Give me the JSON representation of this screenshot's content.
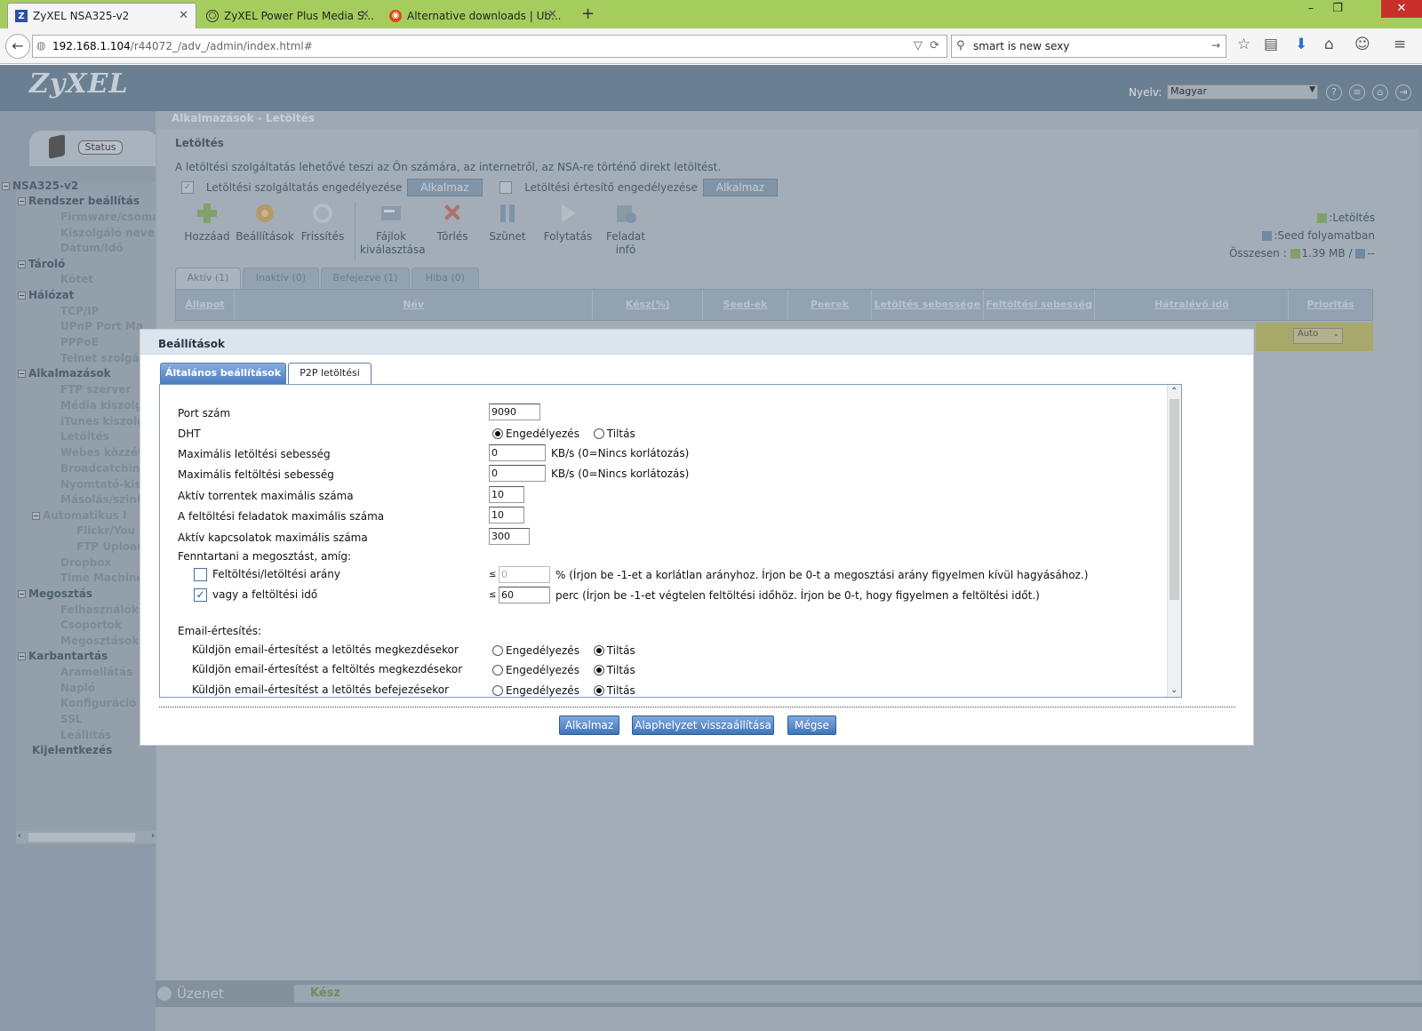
{
  "browser": {
    "tabs": [
      {
        "title": "ZyXEL NSA325-v2"
      },
      {
        "title": "ZyXEL Power Plus Media S..."
      },
      {
        "title": "Alternative downloads | Ub..."
      }
    ],
    "url_host": "192.168.1.104",
    "url_path": "/r44072_/adv_/admin/index.html#",
    "search_value": "smart is new sexy"
  },
  "app": {
    "logo": "ZyXEL",
    "language_label": "Nyelv:",
    "language_value": "Magyar",
    "status_button": "Status",
    "breadcrumb": "Alkalmazások - Letöltés",
    "statusbar": {
      "message": "Üzenet",
      "ready": "Kész"
    }
  },
  "tree": [
    {
      "label": "NSA325-v2"
    },
    {
      "label": "Rendszer beállítás"
    },
    {
      "label": "Firmware/csoma"
    },
    {
      "label": "Kiszolgáló neve"
    },
    {
      "label": "Dátum/Idő"
    },
    {
      "label": "Tároló"
    },
    {
      "label": "Kötet"
    },
    {
      "label": "Hálózat"
    },
    {
      "label": "TCP/IP"
    },
    {
      "label": "UPnP Port Ma"
    },
    {
      "label": "PPPoE"
    },
    {
      "label": "Telnet szolgá"
    },
    {
      "label": "Alkalmazások"
    },
    {
      "label": "FTP szerver"
    },
    {
      "label": "Média kiszolg"
    },
    {
      "label": "iTunes kiszolg"
    },
    {
      "label": "Letöltés"
    },
    {
      "label": "Webes közzét"
    },
    {
      "label": "Broadcatching"
    },
    {
      "label": "Nyomtató-kis"
    },
    {
      "label": "Másolás/szinl"
    },
    {
      "label": "Automatikus I"
    },
    {
      "label": "Flickr/You"
    },
    {
      "label": "FTP Upload"
    },
    {
      "label": "Dropbox"
    },
    {
      "label": "Time Machine"
    },
    {
      "label": "Megosztás"
    },
    {
      "label": "Felhasználók"
    },
    {
      "label": "Csoportok"
    },
    {
      "label": "Megosztások"
    },
    {
      "label": "Karbantartás"
    },
    {
      "label": "Áramellátás"
    },
    {
      "label": "Napló"
    },
    {
      "label": "Konfiguráció"
    },
    {
      "label": "SSL"
    },
    {
      "label": "Leállítás"
    },
    {
      "label": "Kijelentkezés"
    }
  ],
  "download": {
    "title": "Letöltés",
    "description": "A letöltési szolgáltatás lehetővé teszi az Ön számára, az internetről, az NSA-re történő direkt letöltést.",
    "enable_service_label": "Letöltési szolgáltatás engedélyezése",
    "enable_notify_label": "Letöltési értesítő engedélyezése",
    "apply_label": "Alkalmaz",
    "toolbar": {
      "add": "Hozzáad",
      "settings": "Beállítások",
      "refresh": "Frissítés",
      "files_line1": "Fájlok",
      "files_line2": "kiválasztása",
      "delete": "Törlés",
      "pause": "Szünet",
      "resume": "Folytatás",
      "info_line1": "Feladat",
      "info_line2": "infó"
    },
    "legend": {
      "downloading": ":Letöltés",
      "seeding": ":Seed folyamatban",
      "total_label": "Összesen :",
      "total_down": "1.39 MB /",
      "total_up": "--"
    },
    "tabs": [
      "Aktív (1)",
      "Inaktív (0)",
      "Befejezve (1)",
      "Hiba (0)"
    ],
    "columns": [
      "Állapot",
      "Név",
      "Kész(%)",
      "Seed-ek",
      "Peerek",
      "Letöltés sebessége",
      "Feltöltési sebesség",
      "Hátralévő idő",
      "Prioritás"
    ],
    "priority_value": "Auto"
  },
  "modal": {
    "title": "Beállítások",
    "tabs": {
      "general": "Általános beállítások",
      "p2p": "P2P letöltési"
    },
    "fields": {
      "port_label": "Port szám",
      "port_value": "9090",
      "dht_label": "DHT",
      "enable": "Engedélyezés",
      "disable": "Tiltás",
      "maxdl_label": "Maximális letöltési sebesség",
      "maxdl_value": "0",
      "maxdl_unit": "KB/s (0=Nincs korlátozás)",
      "maxul_label": "Maximális feltöltési sebesség",
      "maxul_value": "0",
      "maxul_unit": "KB/s (0=Nincs korlátozás)",
      "maxtor_label": "Aktív torrentek maximális száma",
      "maxtor_value": "10",
      "maxup_label": "A feltöltési feladatok maximális száma",
      "maxup_value": "10",
      "maxconn_label": "Aktív kapcsolatok maximális száma",
      "maxconn_value": "300",
      "seed_label": "Fenntartani a megosztást, amíg:",
      "ratio_label": "Feltöltési/letöltési arány",
      "ratio_le": "≤",
      "ratio_value": "0",
      "ratio_note": "% (Írjon be -1-et a korlátlan arányhoz. Írjon be 0-t a megosztási arány figyelmen kívül hagyásához.)",
      "time_label": "vagy a feltöltési idő",
      "time_le": "≤",
      "time_value": "60",
      "time_note": "perc (Írjon be -1-et végtelen feltöltési időhöz. Írjon be 0-t, hogy figyelmen a feltöltési időt.)",
      "email_label": "Email-értesítés:",
      "email1": "Küldjön email-értesítést a letöltés megkezdésekor",
      "email2": "Küldjön email-értesítést a feltöltés megkezdésekor",
      "email3": "Küldjön email-értesítést a letöltés befejezésekor"
    },
    "buttons": {
      "apply": "Alkalmaz",
      "reset": "Alaphelyzet visszaállítása",
      "cancel": "Mégse"
    }
  },
  "colors": {
    "accent": "#a5cd5e",
    "modal_button": "#3f74bb",
    "highlight_row": "#a8a86a"
  }
}
